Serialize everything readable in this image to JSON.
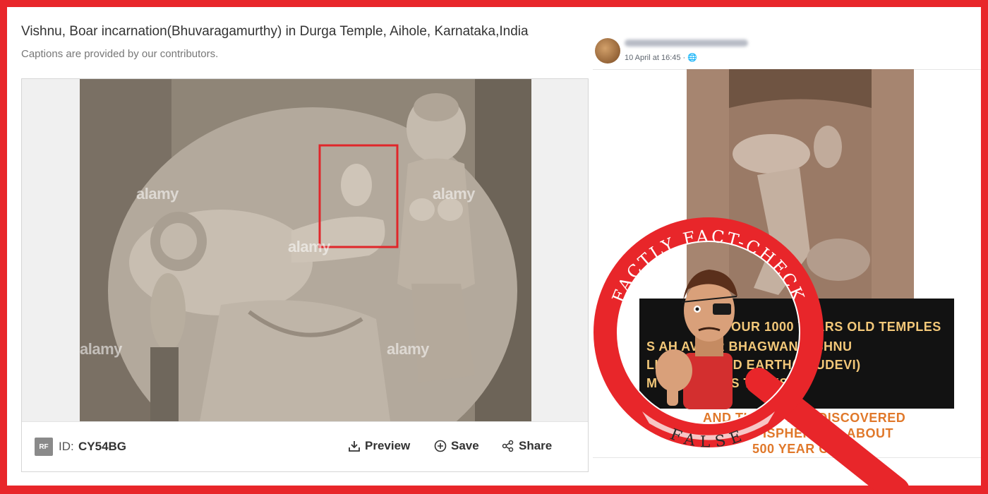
{
  "stock": {
    "title": "Vishnu, Boar incarnation(Bhuvaragamurthy) in Durga Temple, Aihole, Karnataka,India",
    "subtitle": "Captions are provided by our contributors.",
    "watermark": "alamy",
    "footer": {
      "rf_badge": "RF",
      "id_label": "ID:",
      "id_value": "CY54BG",
      "preview_label": "Preview",
      "save_label": "Save",
      "share_label": "Share"
    }
  },
  "fb": {
    "post_time": "10 April at 16:45 ·",
    "overlay_lines": [
      "OUR 1000 YEARS OLD TEMPLES",
      "S      AH AVTAR    BHAGWAN VISHNU",
      "LI          ERICAL      PED EARTH(BHUDEVI)",
      "M OCE    ON HIS TUSKS"
    ],
    "overlay_lines_orange": [
      "AND THEY S      LEO DISCOVERED",
      "ISPHERICAL ABOUT",
      "500 YEAR    O"
    ]
  },
  "stamp": {
    "ring_text": "FACTLY FACT-CHECK",
    "verdict": "FALSE",
    "ring_color": "#e8262a",
    "verdict_bg": "#f7c6c6"
  }
}
